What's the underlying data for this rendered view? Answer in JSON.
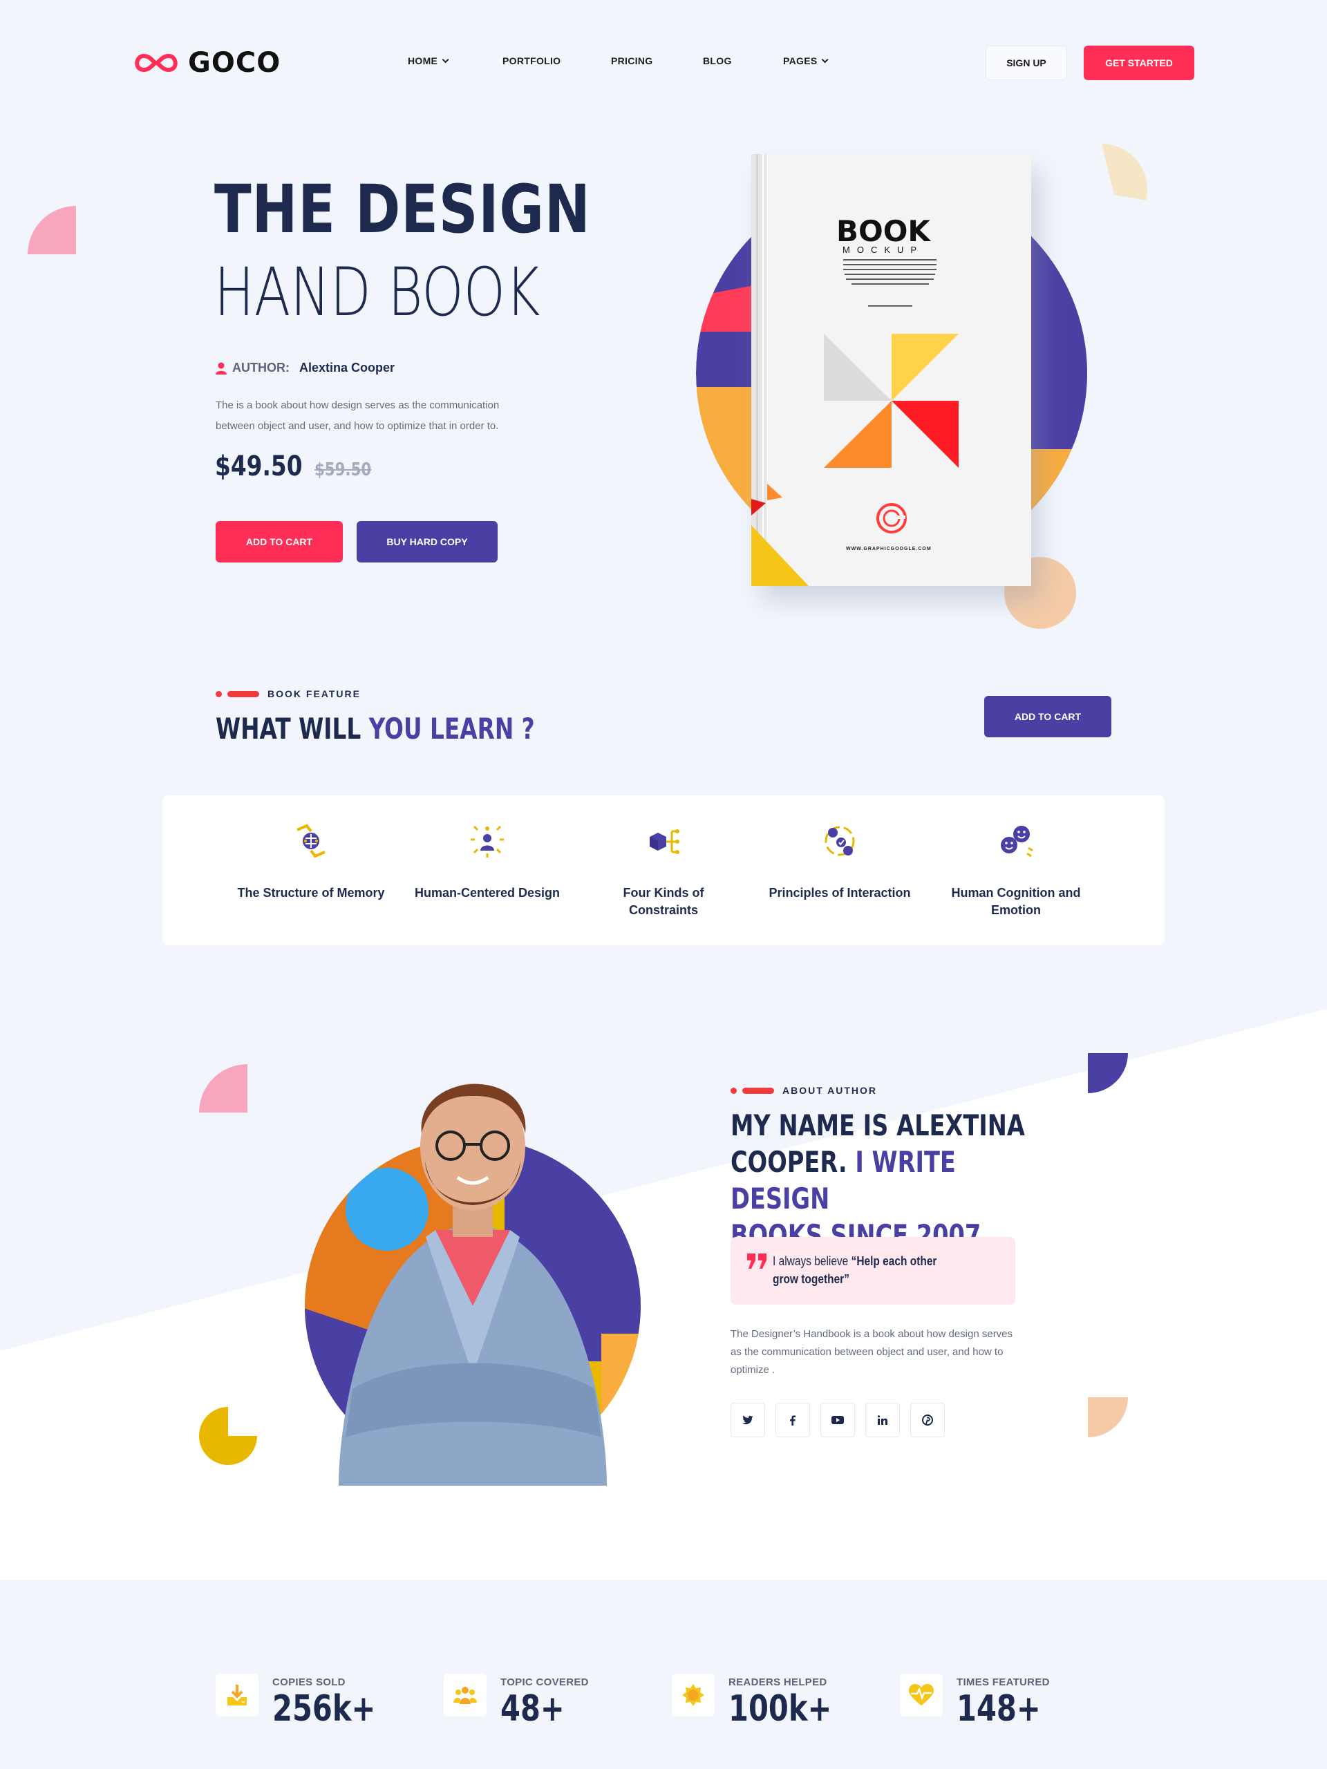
{
  "header": {
    "logo_text": "GOCO",
    "nav": [
      {
        "label": "HOME",
        "has_dropdown": true
      },
      {
        "label": "PORTFOLIO",
        "has_dropdown": false
      },
      {
        "label": "PRICING",
        "has_dropdown": false
      },
      {
        "label": "BLOG",
        "has_dropdown": false
      },
      {
        "label": "PAGES",
        "has_dropdown": true
      }
    ],
    "signup_label": "SIGN UP",
    "get_started_label": "GET STARTED"
  },
  "hero": {
    "title_line1": "THE DESIGN",
    "title_line2": "HAND BOOK",
    "author_label": "AUTHOR:",
    "author_name": "Alextina Cooper",
    "description": "The is a book about how design serves as the communication between object and user, and how to optimize that in order to.",
    "price": "$49.50",
    "old_price": "$59.50",
    "add_to_cart_label": "ADD TO CART",
    "buy_hard_copy_label": "BUY HARD COPY",
    "book": {
      "title": "BOOK",
      "subtitle": "MOCKUP",
      "url": "WWW.GRAPHICGOOGLE.COM"
    }
  },
  "features": {
    "eyebrow": "BOOK FEATURE",
    "title_main": "WHAT WILL ",
    "title_accent": "YOU LEARN ?",
    "add_to_cart_label": "ADD TO CART",
    "items": [
      {
        "label": "The Structure of Memory",
        "icon": "brain-icon"
      },
      {
        "label": "Human-Centered Design",
        "icon": "person-idea-icon"
      },
      {
        "label": "Four Kinds of Constraints",
        "icon": "cube-network-icon"
      },
      {
        "label": "Principles of Interaction",
        "icon": "users-interaction-icon"
      },
      {
        "label": "Human Cognition and Emotion",
        "icon": "emotion-faces-icon"
      }
    ]
  },
  "author": {
    "eyebrow": "ABOUT AUTHOR",
    "heading_line1": "MY NAME IS ALEXTINA",
    "heading_line2_main": "COOPER. ",
    "heading_line2_accent": "I WRITE DESIGN",
    "heading_line3_accent": "BOOKS SINCE 2007",
    "quote_prefix": "I always believe ",
    "quote_bold_line1": "“Help each other",
    "quote_bold_line2": "grow together”",
    "description": "The Designer’s Handbook is a book about how design serves as the communication between object and user, and how to optimize .",
    "socials": [
      "twitter-icon",
      "facebook-icon",
      "youtube-icon",
      "linkedin-icon",
      "pinterest-icon"
    ]
  },
  "stats": [
    {
      "label": "COPIES SOLD",
      "value": "256k+",
      "icon": "download-icon"
    },
    {
      "label": "TOPIC COVERED",
      "value": "48+",
      "icon": "group-icon"
    },
    {
      "label": "READERS HELPED",
      "value": "100k+",
      "icon": "badge-icon"
    },
    {
      "label": "TIMES FEATURED",
      "value": "148+",
      "icon": "heart-pulse-icon"
    }
  ],
  "colors": {
    "brand_red": "#ff2e57",
    "brand_purple": "#4a40a4",
    "navy": "#1d2a4d",
    "yellow": "#e8b800",
    "background": "#f2f6fc"
  }
}
